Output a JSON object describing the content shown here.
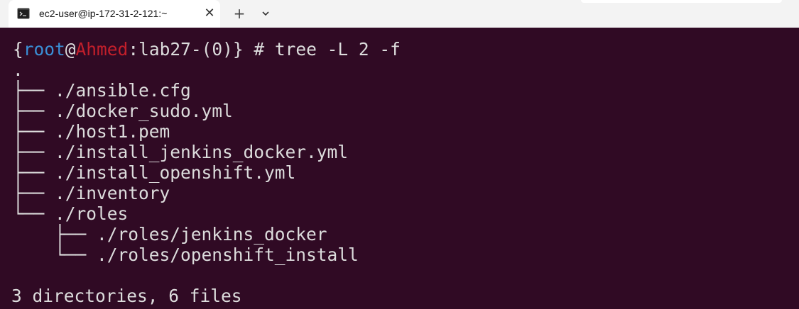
{
  "tab": {
    "title": "ec2-user@ip-172-31-2-121:~",
    "close_glyph": "✕",
    "new_tab_glyph": "+",
    "icon": "terminal-icon"
  },
  "prompt": {
    "open_brace": "{",
    "user": "root",
    "at": "@",
    "host": "Ahmed",
    "path": ":lab27-(0)} # ",
    "command": "tree -L 2 -f"
  },
  "output": [
    ".",
    "├── ./ansible.cfg",
    "├── ./docker_sudo.yml",
    "├── ./host1.pem",
    "├── ./install_jenkins_docker.yml",
    "├── ./install_openshift.yml",
    "├── ./inventory",
    "└── ./roles",
    "    ├── ./roles/jenkins_docker",
    "    └── ./roles/openshift_install",
    "",
    "3 directories, 6 files"
  ],
  "colors": {
    "background": "#300a24",
    "text": "#dcdcdc",
    "user": "#3a8fd6",
    "host": "#c21f2b"
  }
}
